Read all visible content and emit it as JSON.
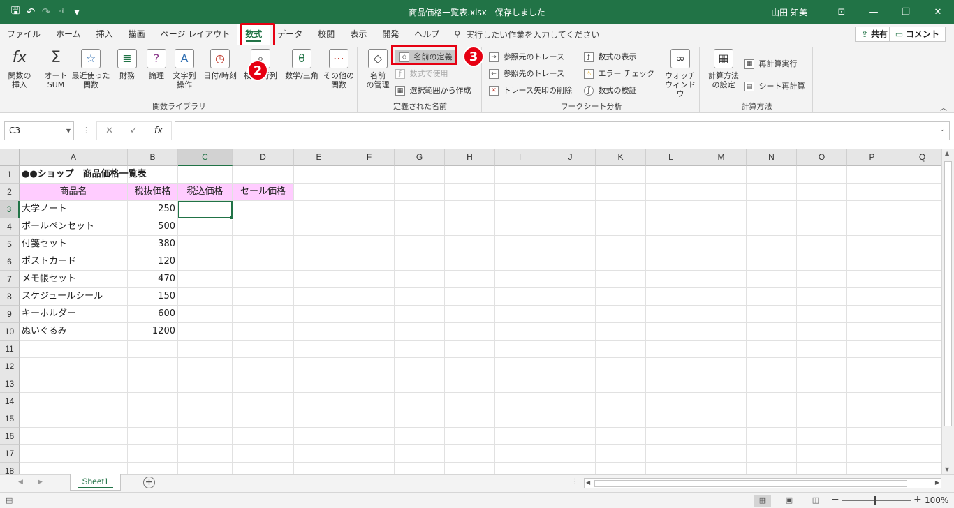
{
  "titlebar": {
    "title": "商品価格一覧表.xlsx  -  保存しました",
    "user": "山田 知美",
    "qat": {
      "save_icon": "save-icon",
      "undo": "↶",
      "redo": "↷",
      "touch": "☝",
      "customize": "▾"
    }
  },
  "tabs": [
    "ファイル",
    "ホーム",
    "挿入",
    "描画",
    "ページ レイアウト",
    "数式",
    "データ",
    "校閲",
    "表示",
    "開発",
    "ヘルプ"
  ],
  "active_tab": "数式",
  "tell_me": "実行したい作業を入力してください",
  "share": "共有",
  "comment": "コメント",
  "ribbon": {
    "function_library": {
      "label": "関数ライブラリ",
      "insert_function": "関数の\n挿入",
      "autosum": "オート\nSUM",
      "recent": "最近使った\n関数",
      "financial": "財務",
      "logical": "論理",
      "text": "文字列\n操作",
      "datetime": "日付/時刻",
      "lookup": "検索/行列",
      "math": "数学/三角",
      "more": "その他の\n関数"
    },
    "defined_names": {
      "label": "定義された名前",
      "name_manager": "名前\nの管理",
      "define_name": "名前の定義",
      "use_in_formula": "数式で使用",
      "create_from_selection": "選択範囲から作成"
    },
    "formula_auditing": {
      "label": "ワークシート分析",
      "trace_precedents": "参照元のトレース",
      "trace_dependents": "参照先のトレース",
      "remove_arrows": "トレース矢印の削除",
      "show_formulas": "数式の表示",
      "error_checking": "エラー チェック",
      "evaluate_formula": "数式の検証",
      "watch_window": "ウォッチ\nウィンドウ"
    },
    "calculation": {
      "label": "計算方法",
      "calc_options": "計算方法\nの設定",
      "calc_now": "再計算実行",
      "calc_sheet": "シート再計算"
    }
  },
  "annotations": {
    "step2": "2",
    "step3": "3"
  },
  "formula_bar": {
    "name_box": "C3",
    "cancel": "✕",
    "enter": "✓",
    "fx": "fx",
    "formula": ""
  },
  "columns": [
    "A",
    "B",
    "C",
    "D",
    "E",
    "F",
    "G",
    "H",
    "I",
    "J",
    "K",
    "L",
    "M",
    "N",
    "O",
    "P",
    "Q"
  ],
  "rows": [
    "1",
    "2",
    "3",
    "4",
    "5",
    "6",
    "7",
    "8",
    "9",
    "10",
    "11",
    "12",
    "13",
    "14",
    "15",
    "16",
    "17",
    "18"
  ],
  "sheet": {
    "title": "●●ショップ　商品価格一覧表",
    "headers": [
      "商品名",
      "税抜価格",
      "税込価格",
      "セール価格"
    ],
    "products": [
      {
        "name": "大学ノート",
        "price": "250"
      },
      {
        "name": "ボールペンセット",
        "price": "500"
      },
      {
        "name": "付箋セット",
        "price": "380"
      },
      {
        "name": "ポストカード",
        "price": "120"
      },
      {
        "name": "メモ帳セット",
        "price": "470"
      },
      {
        "name": "スケジュールシール",
        "price": "150"
      },
      {
        "name": "キーホルダー",
        "price": "600"
      },
      {
        "name": "ぬいぐるみ",
        "price": "1200"
      }
    ]
  },
  "sheet_tabs": [
    "Sheet1"
  ],
  "status": {
    "zoom": "100%"
  },
  "colors": {
    "accent": "#217346",
    "highlight": "#e60012",
    "header_fill": "#ffccff"
  }
}
